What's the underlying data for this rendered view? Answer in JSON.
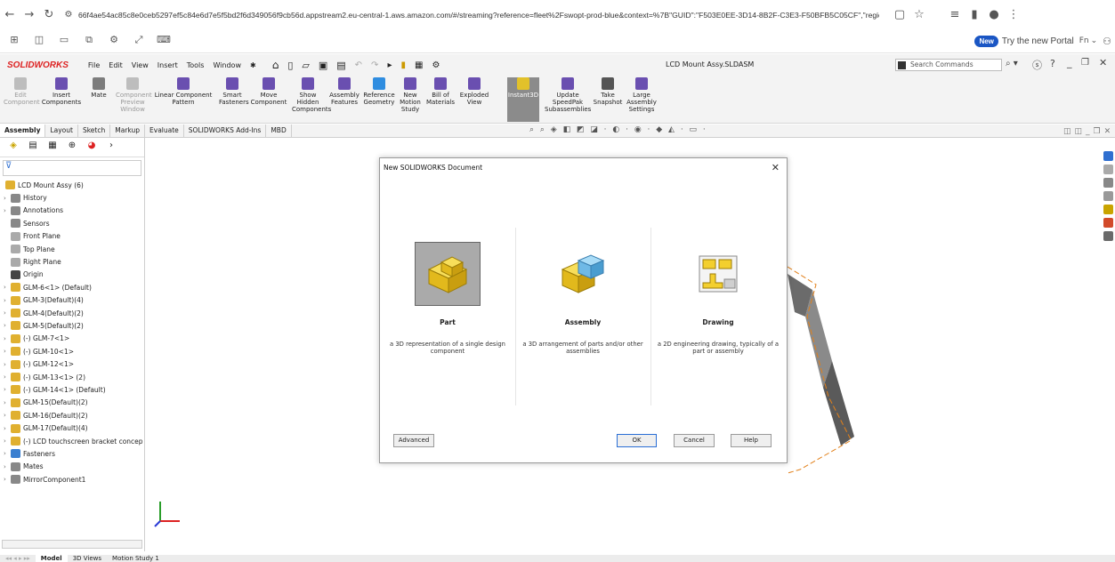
{
  "browser": {
    "url": "66f4ae54ac85c8e0ceb5297ef5c84e6d7e5f5bd2f6d349056f9cb56d.appstream2.eu-central-1.aws.amazon.com/#/streaming?reference=fleet%2Fswopt-prod-blue&context=%7B\"GUID\":\"F503E0EE-3D14-8B2F-C3E3-F50BFB5C05CF\",\"region\":\"eu-central...",
    "new_badge": "New",
    "portal_text": "Try the new Portal",
    "lang": "Fn"
  },
  "sw": {
    "logo": "SOLIDWORKS",
    "menus": [
      "File",
      "Edit",
      "View",
      "Insert",
      "Tools",
      "Window"
    ],
    "doc_title": "LCD Mount Assy.SLDASM",
    "search_placeholder": "Search Commands"
  },
  "ribbon": [
    {
      "label": "Edit\nComponent",
      "disabled": true,
      "color": "#bdbdbd"
    },
    {
      "label": "Insert\nComponents",
      "disabled": false,
      "color": "#6a4fb0"
    },
    {
      "label": "Mate",
      "disabled": false,
      "color": "#7c7c7c"
    },
    {
      "label": "Component\nPreview\nWindow",
      "disabled": true,
      "color": "#bdbdbd"
    },
    {
      "label": "Linear Component\nPattern",
      "disabled": false,
      "color": "#6a4fb0"
    },
    {
      "label": "Smart\nFasteners",
      "disabled": false,
      "color": "#6a4fb0"
    },
    {
      "label": "Move\nComponent",
      "disabled": false,
      "color": "#6a4fb0"
    },
    {
      "label": "Show\nHidden\nComponents",
      "disabled": false,
      "color": "#6a4fb0"
    },
    {
      "label": "Assembly\nFeatures",
      "disabled": false,
      "color": "#6a4fb0"
    },
    {
      "label": "Reference\nGeometry",
      "disabled": false,
      "color": "#2f8de0"
    },
    {
      "label": "New\nMotion\nStudy",
      "disabled": false,
      "color": "#6a4fb0"
    },
    {
      "label": "Bill of\nMaterials",
      "disabled": false,
      "color": "#6a4fb0"
    },
    {
      "label": "Exploded\nView",
      "disabled": false,
      "color": "#6a4fb0"
    },
    {
      "label": "Instant3D",
      "disabled": false,
      "color": "#e2c12a",
      "active": true
    },
    {
      "label": "Update\nSpeedPak\nSubassemblies",
      "disabled": false,
      "color": "#6a4fb0"
    },
    {
      "label": "Take\nSnapshot",
      "disabled": false,
      "color": "#555555"
    },
    {
      "label": "Large\nAssembly\nSettings",
      "disabled": false,
      "color": "#6a4fb0"
    }
  ],
  "tabs": [
    "Assembly",
    "Layout",
    "Sketch",
    "Markup",
    "Evaluate",
    "SOLIDWORKS Add-Ins",
    "MBD"
  ],
  "tree": {
    "root": "LCD Mount Assy  (6)",
    "items": [
      {
        "label": "History",
        "arrow": true,
        "color": "#888888"
      },
      {
        "label": "Annotations",
        "arrow": true,
        "color": "#888888"
      },
      {
        "label": "Sensors",
        "arrow": false,
        "color": "#888888"
      },
      {
        "label": "Front Plane",
        "arrow": false,
        "color": "#aaaaaa"
      },
      {
        "label": "Top Plane",
        "arrow": false,
        "color": "#aaaaaa"
      },
      {
        "label": "Right Plane",
        "arrow": false,
        "color": "#aaaaaa"
      },
      {
        "label": "Origin",
        "arrow": false,
        "color": "#444444"
      },
      {
        "label": "GLM-6<1> (Default)",
        "arrow": true,
        "color": "#e0b030"
      },
      {
        "label": "GLM-3(Default)(4)",
        "arrow": true,
        "color": "#e0b030"
      },
      {
        "label": "GLM-4(Default)(2)",
        "arrow": true,
        "color": "#e0b030"
      },
      {
        "label": "GLM-5(Default)(2)",
        "arrow": true,
        "color": "#e0b030"
      },
      {
        "label": "(-) GLM-7<1>",
        "arrow": true,
        "color": "#e0b030"
      },
      {
        "label": "(-) GLM-10<1>",
        "arrow": true,
        "color": "#e0b030"
      },
      {
        "label": "(-) GLM-12<1>",
        "arrow": true,
        "color": "#e0b030"
      },
      {
        "label": "(-) GLM-13<1> (2)",
        "arrow": true,
        "color": "#e0b030"
      },
      {
        "label": "(-) GLM-14<1> (Default)",
        "arrow": true,
        "color": "#e0b030"
      },
      {
        "label": "GLM-15(Default)(2)",
        "arrow": true,
        "color": "#e0b030"
      },
      {
        "label": "GLM-16(Default)(2)",
        "arrow": true,
        "color": "#e0b030"
      },
      {
        "label": "GLM-17(Default)(4)",
        "arrow": true,
        "color": "#e0b030"
      },
      {
        "label": "(-) LCD touchscreen bracket concep",
        "arrow": true,
        "color": "#e0b030"
      },
      {
        "label": "Fasteners",
        "arrow": true,
        "color": "#3a7fd0"
      },
      {
        "label": "Mates",
        "arrow": true,
        "color": "#888888"
      },
      {
        "label": "MirrorComponent1",
        "arrow": true,
        "color": "#888888"
      }
    ]
  },
  "bottom_tabs": [
    "Model",
    "3D Views",
    "Motion Study 1"
  ],
  "dialog": {
    "title": "New SOLIDWORKS Document",
    "options": [
      {
        "label": "Part",
        "desc": "a 3D representation of a single design component",
        "selected": true
      },
      {
        "label": "Assembly",
        "desc": "a 3D arrangement of parts and/or other assemblies",
        "selected": false
      },
      {
        "label": "Drawing",
        "desc": "a 2D engineering drawing, typically of a part or assembly",
        "selected": false
      }
    ],
    "buttons": {
      "advanced": "Advanced",
      "ok": "OK",
      "cancel": "Cancel",
      "help": "Help"
    }
  },
  "colors": {
    "part_yellow": "#f3cf2e",
    "assembly_blue": "#6fb9e6",
    "sw_red": "#d22222",
    "accent_blue": "#2a6fd6"
  }
}
